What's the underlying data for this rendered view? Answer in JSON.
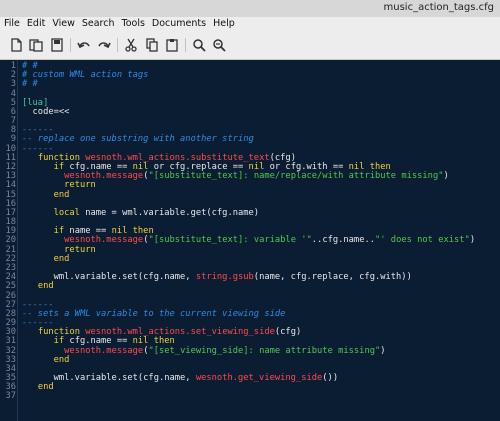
{
  "window": {
    "title": "music_action_tags.cfg"
  },
  "menu": [
    "File",
    "Edit",
    "View",
    "Search",
    "Tools",
    "Documents",
    "Help"
  ],
  "toolbar": {
    "buttons": [
      {
        "name": "new-document",
        "icon": "new-document-icon"
      },
      {
        "name": "open-document",
        "icon": "open-document-icon"
      },
      {
        "name": "save-document",
        "icon": "save-document-icon"
      },
      {
        "name": "undo",
        "icon": "undo-icon"
      },
      {
        "name": "redo",
        "icon": "redo-icon"
      },
      {
        "name": "cut",
        "icon": "cut-icon"
      },
      {
        "name": "copy",
        "icon": "copy-icon"
      },
      {
        "name": "paste",
        "icon": "paste-icon"
      },
      {
        "name": "search",
        "icon": "search-icon"
      },
      {
        "name": "search-replace",
        "icon": "search-replace-icon"
      }
    ]
  },
  "colors": {
    "background": "#0b1d33",
    "comment": "#2e8be8",
    "keyword": "#f0d23b",
    "function": "#ff4a4a",
    "string": "#4ec94e",
    "text": "#e9e9e9",
    "tag": "#49c2a6"
  },
  "lines": [
    [
      [
        "c",
        "# #"
      ]
    ],
    [
      [
        "c",
        "# custom WML action tags"
      ]
    ],
    [
      [
        "c",
        "# #"
      ]
    ],
    [],
    [
      [
        "g",
        "[lua]"
      ]
    ],
    [
      [
        "t",
        "  code=<<"
      ]
    ],
    [],
    [
      [
        "c",
        "------"
      ]
    ],
    [
      [
        "c",
        "-- replace one substring with another string"
      ]
    ],
    [
      [
        "c",
        "------"
      ]
    ],
    [
      [
        "t",
        "   "
      ],
      [
        "k",
        "function "
      ],
      [
        "f",
        "wesnoth.wml_actions.substitute_text"
      ],
      [
        "t",
        "(cfg)"
      ]
    ],
    [
      [
        "t",
        "      "
      ],
      [
        "k",
        "if "
      ],
      [
        "t",
        "cfg.name == "
      ],
      [
        "k",
        "nil "
      ],
      [
        "t",
        "or cfg.replace == "
      ],
      [
        "k",
        "nil "
      ],
      [
        "t",
        "or cfg.with == "
      ],
      [
        "k",
        "nil then"
      ]
    ],
    [
      [
        "t",
        "        "
      ],
      [
        "f",
        "wesnoth.message"
      ],
      [
        "t",
        "("
      ],
      [
        "s",
        "\"[substitute_text]: name/replace/with attribute missing\""
      ],
      [
        "t",
        ")"
      ]
    ],
    [
      [
        "t",
        "        "
      ],
      [
        "k",
        "return"
      ]
    ],
    [
      [
        "t",
        "      "
      ],
      [
        "k",
        "end"
      ]
    ],
    [],
    [
      [
        "t",
        "      "
      ],
      [
        "k",
        "local "
      ],
      [
        "t",
        "name = wml.variable.get(cfg.name)"
      ]
    ],
    [],
    [
      [
        "t",
        "      "
      ],
      [
        "k",
        "if "
      ],
      [
        "t",
        "name == "
      ],
      [
        "k",
        "nil then"
      ]
    ],
    [
      [
        "t",
        "        "
      ],
      [
        "f",
        "wesnoth.message"
      ],
      [
        "t",
        "("
      ],
      [
        "s",
        "\"[substitute_text]: variable '\""
      ],
      [
        "t",
        "..cfg.name.."
      ],
      [
        "s",
        "\"' does not exist\""
      ],
      [
        "t",
        ")"
      ]
    ],
    [
      [
        "t",
        "        "
      ],
      [
        "k",
        "return"
      ]
    ],
    [
      [
        "t",
        "      "
      ],
      [
        "k",
        "end"
      ]
    ],
    [],
    [
      [
        "t",
        "      wml.variable.set(cfg.name, "
      ],
      [
        "f",
        "string.gsub"
      ],
      [
        "t",
        "(name, cfg.replace, cfg.with))"
      ]
    ],
    [
      [
        "t",
        "   "
      ],
      [
        "k",
        "end"
      ]
    ],
    [],
    [
      [
        "c",
        "------"
      ]
    ],
    [
      [
        "c",
        "-- sets a WML variable to the current viewing side"
      ]
    ],
    [
      [
        "c",
        "------"
      ]
    ],
    [
      [
        "t",
        "   "
      ],
      [
        "k",
        "function "
      ],
      [
        "f",
        "wesnoth.wml_actions.set_viewing_side"
      ],
      [
        "t",
        "(cfg)"
      ]
    ],
    [
      [
        "t",
        "      "
      ],
      [
        "k",
        "if "
      ],
      [
        "t",
        "cfg.name == "
      ],
      [
        "k",
        "nil then"
      ]
    ],
    [
      [
        "t",
        "        "
      ],
      [
        "f",
        "wesnoth.message"
      ],
      [
        "t",
        "("
      ],
      [
        "s",
        "\"[set_viewing_side]: name attribute missing\""
      ],
      [
        "t",
        ")"
      ]
    ],
    [
      [
        "t",
        "      "
      ],
      [
        "k",
        "end"
      ]
    ],
    [],
    [
      [
        "t",
        "      wml.variable.set(cfg.name, "
      ],
      [
        "f",
        "wesnoth.get_viewing_side"
      ],
      [
        "t",
        "())"
      ]
    ],
    [
      [
        "t",
        "   "
      ],
      [
        "k",
        "end"
      ]
    ],
    []
  ]
}
